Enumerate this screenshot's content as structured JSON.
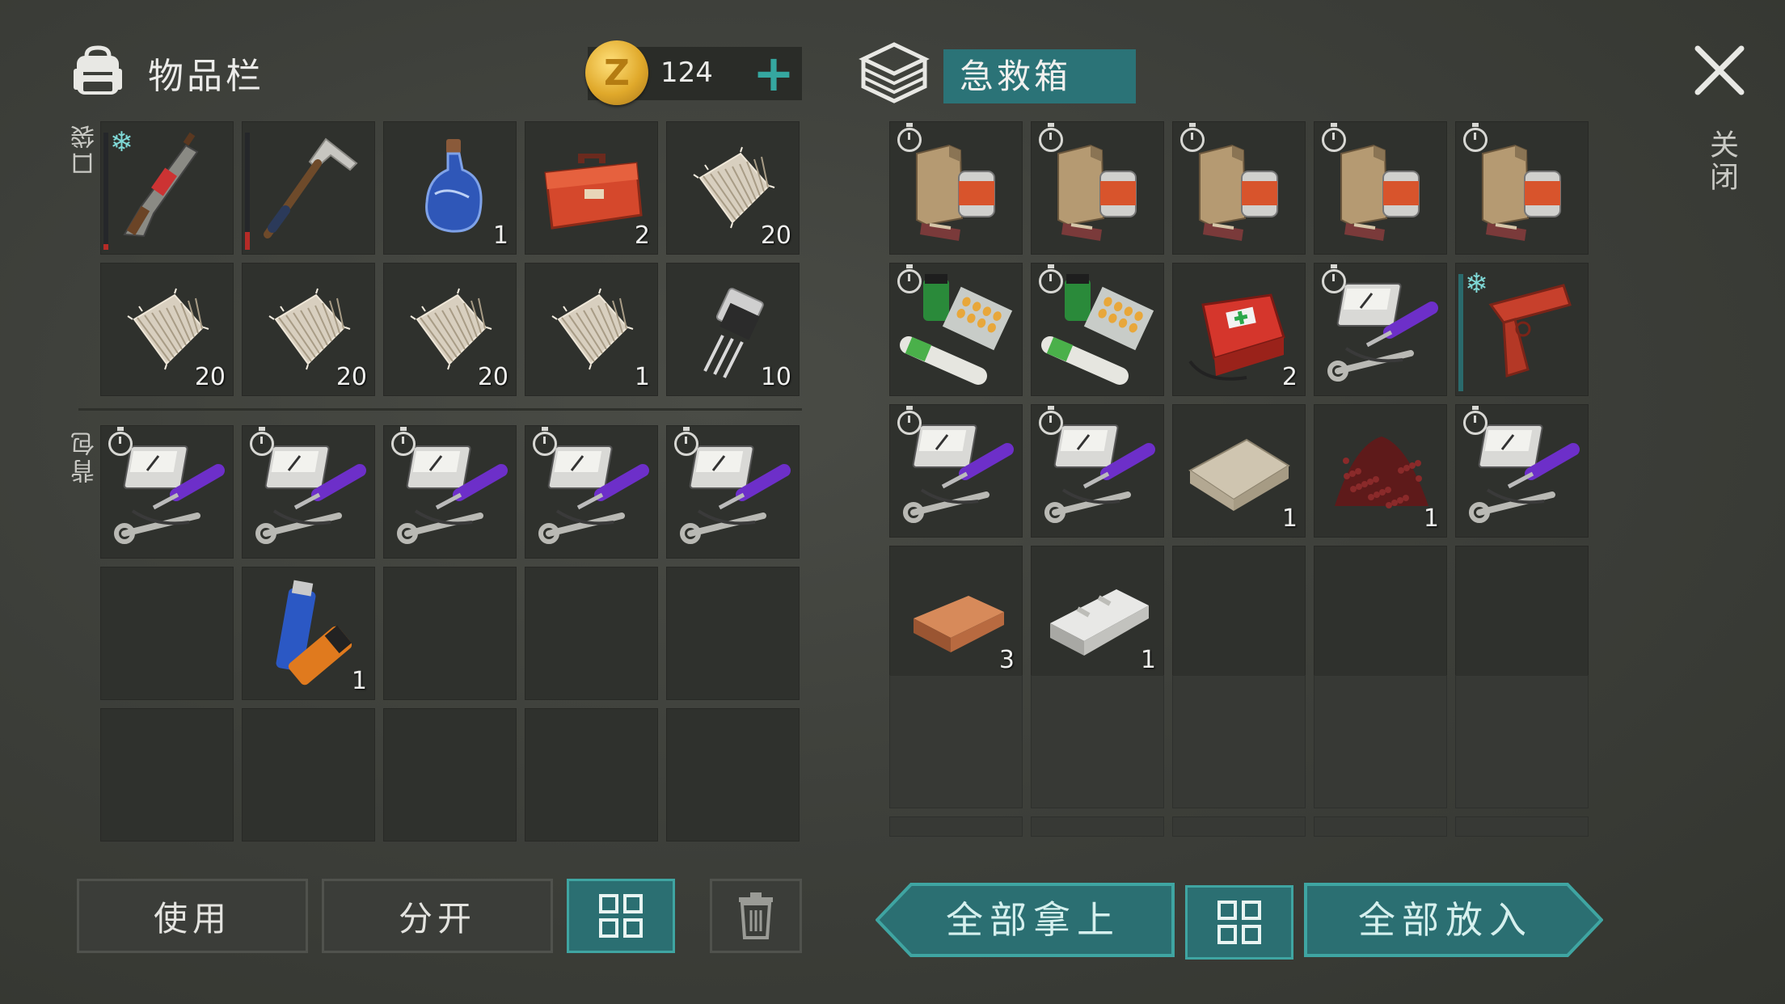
{
  "inventory": {
    "title": "物品栏",
    "coins": "124",
    "coin_symbol": "Z",
    "add_symbol": "+",
    "pocket_label": "口袋",
    "backpack_label": "背包",
    "pockets": [
      {
        "icon": "flare-rifle-icon",
        "count": "",
        "frozen": true,
        "durability": 0.05
      },
      {
        "icon": "hammer-icon",
        "count": "",
        "durability": 0.15
      },
      {
        "icon": "blue-bottle-icon",
        "count": "1"
      },
      {
        "icon": "repair-kit-icon",
        "count": "2"
      },
      {
        "icon": "fabric-icon",
        "count": "20"
      },
      {
        "icon": "fabric-icon",
        "count": "20"
      },
      {
        "icon": "fabric-icon",
        "count": "20"
      },
      {
        "icon": "fabric-icon",
        "count": "20"
      },
      {
        "icon": "fabric-icon",
        "count": "1"
      },
      {
        "icon": "transistor-icon",
        "count": "10"
      }
    ],
    "backpack": [
      {
        "icon": "tool-set-icon",
        "count": "",
        "timer": true
      },
      {
        "icon": "tool-set-icon",
        "count": "",
        "timer": true
      },
      {
        "icon": "tool-set-icon",
        "count": "",
        "timer": true
      },
      {
        "icon": "tool-set-icon",
        "count": "",
        "timer": true
      },
      {
        "icon": "tool-set-icon",
        "count": "",
        "timer": true
      },
      {
        "icon": "",
        "count": ""
      },
      {
        "icon": "batteries-icon",
        "count": "1"
      },
      {
        "icon": "",
        "count": ""
      },
      {
        "icon": "",
        "count": ""
      },
      {
        "icon": "",
        "count": ""
      },
      {
        "icon": "",
        "count": ""
      },
      {
        "icon": "",
        "count": ""
      },
      {
        "icon": "",
        "count": ""
      },
      {
        "icon": "",
        "count": ""
      },
      {
        "icon": "",
        "count": ""
      }
    ],
    "buttons": {
      "use": "使用",
      "split": "分开"
    }
  },
  "chest": {
    "title": "急救箱",
    "items": [
      {
        "icon": "food-ration-icon",
        "count": "",
        "timer": true
      },
      {
        "icon": "food-ration-icon",
        "count": "",
        "timer": true
      },
      {
        "icon": "food-ration-icon",
        "count": "",
        "timer": true
      },
      {
        "icon": "food-ration-icon",
        "count": "",
        "timer": true
      },
      {
        "icon": "food-ration-icon",
        "count": "",
        "timer": true
      },
      {
        "icon": "medicine-icon",
        "count": "",
        "timer": true
      },
      {
        "icon": "medicine-icon",
        "count": "",
        "timer": true
      },
      {
        "icon": "first-aid-kit-icon",
        "count": "2"
      },
      {
        "icon": "tool-set-icon",
        "count": "",
        "timer": true
      },
      {
        "icon": "flare-gun-icon",
        "count": "",
        "frozen": true,
        "durability": 1.0
      },
      {
        "icon": "tool-set-icon",
        "count": "",
        "timer": true
      },
      {
        "icon": "tool-set-icon",
        "count": "",
        "timer": true
      },
      {
        "icon": "bandage-roll-icon",
        "count": "1"
      },
      {
        "icon": "seeds-pile-icon",
        "count": "1"
      },
      {
        "icon": "tool-set-icon",
        "count": "",
        "timer": true
      },
      {
        "icon": "copper-ingot-icon",
        "count": "3"
      },
      {
        "icon": "aluminum-bar-icon",
        "count": "1"
      },
      {
        "icon": "",
        "count": ""
      },
      {
        "icon": "",
        "count": ""
      },
      {
        "icon": "",
        "count": ""
      }
    ],
    "buttons": {
      "take_all": "全部拿上",
      "put_all": "全部放入"
    }
  },
  "close_label": "关闭",
  "colors": {
    "accent": "#2b7377",
    "accent_border": "#3fa5a2",
    "coin": "#e0a92b",
    "durability": "#b52b27"
  }
}
